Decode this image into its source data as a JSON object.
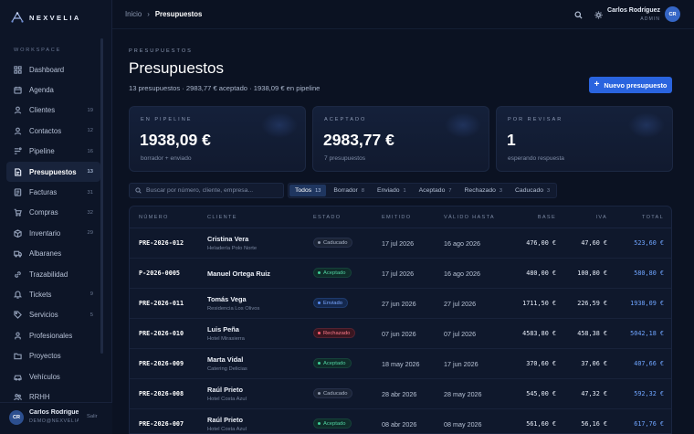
{
  "app": {
    "brand": "NEXVELIA"
  },
  "sidebar": {
    "section_label": "WORKSPACE",
    "items": [
      {
        "label": "Dashboard",
        "icon": "dashboard-icon",
        "count": ""
      },
      {
        "label": "Agenda",
        "icon": "calendar-icon",
        "count": ""
      },
      {
        "label": "Clientes",
        "icon": "user-icon",
        "count": "19"
      },
      {
        "label": "Contactos",
        "icon": "contact-icon",
        "count": "12"
      },
      {
        "label": "Pipeline",
        "icon": "pipeline-icon",
        "count": "16"
      },
      {
        "label": "Presupuestos",
        "icon": "quote-icon",
        "count": "13",
        "active": true
      },
      {
        "label": "Facturas",
        "icon": "invoice-icon",
        "count": "31"
      },
      {
        "label": "Compras",
        "icon": "cart-icon",
        "count": "32"
      },
      {
        "label": "Inventario",
        "icon": "box-icon",
        "count": "29"
      },
      {
        "label": "Albaranes",
        "icon": "truck-icon",
        "count": ""
      },
      {
        "label": "Trazabilidad",
        "icon": "link-icon",
        "count": ""
      },
      {
        "label": "Tickets",
        "icon": "ticket-icon",
        "count": "9"
      },
      {
        "label": "Servicios",
        "icon": "tag-icon",
        "count": "5"
      },
      {
        "label": "Profesionales",
        "icon": "person-icon",
        "count": ""
      },
      {
        "label": "Proyectos",
        "icon": "folder-icon",
        "count": ""
      },
      {
        "label": "Vehículos",
        "icon": "vehicle-icon",
        "count": ""
      },
      {
        "label": "RRHH",
        "icon": "people-icon",
        "count": ""
      }
    ],
    "user": {
      "initials": "CR",
      "name": "Carlos Rodríguez",
      "email": "DEMO@NEXVELIA.COM",
      "logout": "Salir"
    }
  },
  "topbar": {
    "breadcrumb": {
      "home": "Inicio",
      "separator": "›",
      "current": "Presupuestos"
    },
    "user": {
      "name": "Carlos Rodríguez",
      "role": "ADMIN",
      "initials": "CR"
    }
  },
  "header": {
    "eyebrow": "PRESUPUESTOS",
    "title": "Presupuestos",
    "subtitle": "13 presupuestos · 2983,77 € aceptado · 1938,09 € en pipeline",
    "new_button": "Nuevo presupuesto"
  },
  "stats": [
    {
      "label": "EN PIPELINE",
      "value": "1938,09 €",
      "note": "borrador + enviado"
    },
    {
      "label": "ACEPTADO",
      "value": "2983,77 €",
      "note": "7 presupuestos"
    },
    {
      "label": "POR REVISAR",
      "value": "1",
      "note": "esperando respuesta"
    }
  ],
  "search": {
    "placeholder": "Buscar por número, cliente, empresa..."
  },
  "filters": [
    {
      "label": "Todos",
      "count": "13",
      "active": true
    },
    {
      "label": "Borrador",
      "count": "8"
    },
    {
      "label": "Enviado",
      "count": "1"
    },
    {
      "label": "Aceptado",
      "count": "7"
    },
    {
      "label": "Rechazado",
      "count": "3"
    },
    {
      "label": "Caducado",
      "count": "3"
    }
  ],
  "table": {
    "columns": [
      "NÚMERO",
      "CLIENTE",
      "ESTADO",
      "EMITIDO",
      "VÁLIDO HASTA",
      "BASE",
      "IVA",
      "TOTAL"
    ],
    "rows": [
      {
        "number": "PRE-2026-012",
        "client": "Cristina Vera",
        "company": "Heladería Polo Norte",
        "status": "Caducado",
        "status_key": "caducado",
        "issued": "17 jul 2026",
        "valid": "16 ago 2026",
        "base": "476,00 €",
        "iva": "47,60 €",
        "total": "523,60 €"
      },
      {
        "number": "P-2026-0005",
        "client": "Manuel Ortega Ruiz",
        "company": "",
        "status": "Aceptado",
        "status_key": "aceptado",
        "issued": "17 jul 2026",
        "valid": "16 ago 2026",
        "base": "480,00 €",
        "iva": "100,80 €",
        "total": "580,80 €"
      },
      {
        "number": "PRE-2026-011",
        "client": "Tomás Vega",
        "company": "Residencia Los Olivos",
        "status": "Enviado",
        "status_key": "enviado",
        "issued": "27 jun 2026",
        "valid": "27 jul 2026",
        "base": "1711,50 €",
        "iva": "226,59 €",
        "total": "1938,09 €"
      },
      {
        "number": "PRE-2026-010",
        "client": "Luis Peña",
        "company": "Hotel Mirasierra",
        "status": "Rechazado",
        "status_key": "rechazado",
        "issued": "07 jun 2026",
        "valid": "07 jul 2026",
        "base": "4583,80 €",
        "iva": "458,38 €",
        "total": "5042,18 €"
      },
      {
        "number": "PRE-2026-009",
        "client": "Marta Vidal",
        "company": "Catering Delicias",
        "status": "Aceptado",
        "status_key": "aceptado",
        "issued": "18 may 2026",
        "valid": "17 jun 2026",
        "base": "370,60 €",
        "iva": "37,06 €",
        "total": "407,66 €"
      },
      {
        "number": "PRE-2026-008",
        "client": "Raúl Prieto",
        "company": "Hotel Costa Azul",
        "status": "Caducado",
        "status_key": "caducado",
        "issued": "28 abr 2026",
        "valid": "28 may 2026",
        "base": "545,00 €",
        "iva": "47,32 €",
        "total": "592,32 €"
      },
      {
        "number": "PRE-2026-007",
        "client": "Raúl Prieto",
        "company": "Hotel Costa Azul",
        "status": "Aceptado",
        "status_key": "aceptado",
        "issued": "08 abr 2026",
        "valid": "08 may 2026",
        "base": "561,60 €",
        "iva": "56,16 €",
        "total": "617,76 €"
      }
    ]
  }
}
